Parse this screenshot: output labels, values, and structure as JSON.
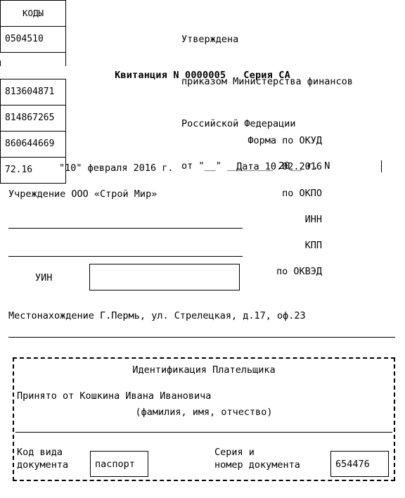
{
  "document": {
    "kind": "receipt-form",
    "language": "ru"
  },
  "approval_block": {
    "line1": "Утверждена",
    "line2": "приказом Министерства финансов",
    "line3": "Российской Федерации",
    "line4": "от \"__\" ________ 20__ г. N"
  },
  "title": {
    "receipt_word": "Квитанция",
    "number_label": "N",
    "number": "0000005",
    "series_label": "Серия",
    "series": "СА",
    "full": "Квитанция N 0000005   Серия СА"
  },
  "codes_table": {
    "header": "КОДЫ",
    "rows": [
      {
        "label": "Форма по ОКУД",
        "value": "0504510"
      },
      {
        "label": "Дата",
        "value": "10.02.2016"
      },
      {
        "label": "по ОКПО",
        "value": "813604871"
      },
      {
        "label": "ИНН",
        "value": "814867265"
      },
      {
        "label": "КПП",
        "value": "860644669"
      },
      {
        "label": "по ОКВЭД",
        "value": "72.16"
      }
    ],
    "okud_label": "Форма по ОКУД",
    "okud_value": "0504510",
    "date_text": "Дата 10.02.2016",
    "okpo_label": "по ОКПО",
    "okpo_value": "813604871",
    "inn_label": "ИНН",
    "inn_value": "814867265",
    "kpp_label": "КПП",
    "kpp_value": "860644669",
    "okved_label": "по ОКВЭД",
    "okved_value": "72.16"
  },
  "left_fields": {
    "date_written": "\"10\" февраля 2016 г.",
    "institution_label": "Учреждение",
    "institution_value": "ООО «Строй Мир»",
    "institution_line": "Учреждение ООО «Строй Мир»",
    "uin_label": "УИН",
    "uin_value": "",
    "location_label": "Местонахождение",
    "location_value": "Г.Пермь, ул. Стрелецкая, д.17, оф.23",
    "location_line": "Местонахождение Г.Пермь, ул. Стрелецкая, д.17, оф.23"
  },
  "payer_block": {
    "title": "Идентификация Плательщика",
    "accepted_from_label": "Принято от",
    "accepted_from_value": "Кошкина Ивана Ивановича",
    "accepted_from_line": "Принято от Кошкина Ивана Ивановича",
    "fio_hint": "(фамилия, имя, отчество)",
    "doc_kind_label_line1": "Код вида",
    "doc_kind_label_line2": "документа",
    "doc_kind_value": "паспорт",
    "doc_number_label_line1": "Серия и",
    "doc_number_label_line2": "номер документа",
    "doc_number_value": "654476"
  },
  "colors": {
    "ink": "#000000",
    "paper": "#ffffff"
  }
}
